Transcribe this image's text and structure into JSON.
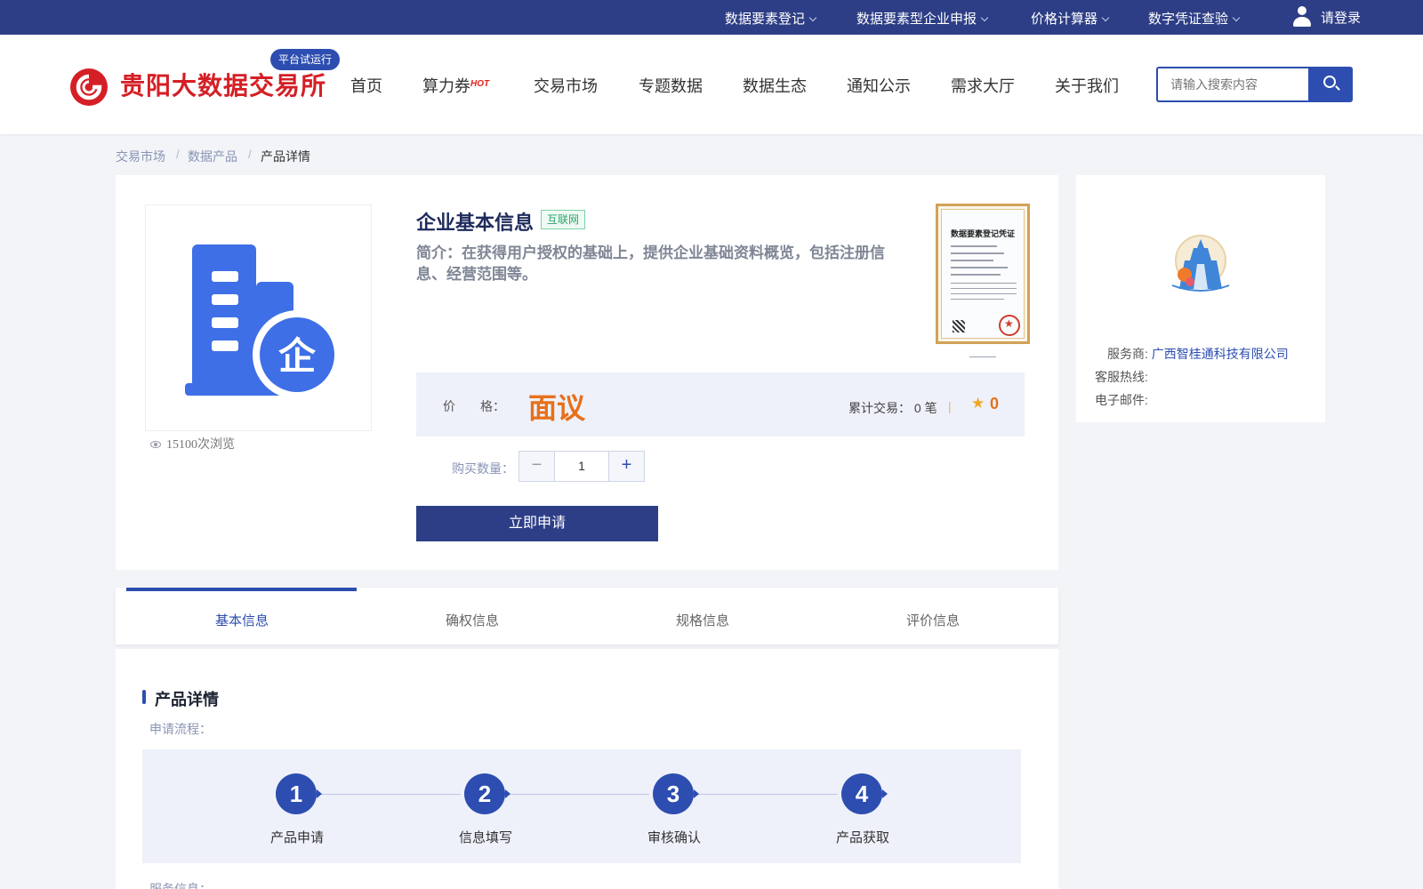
{
  "topbar": {
    "links": [
      "数据要素登记",
      "数据要素型企业申报",
      "价格计算器",
      "数字凭证查验"
    ],
    "login_label": "请登录"
  },
  "header": {
    "logo_text": "贵阳大数据交易所",
    "beta_badge": "平台试运行",
    "nav": [
      "首页",
      "算力券",
      "交易市场",
      "专题数据",
      "数据生态",
      "通知公示",
      "需求大厅",
      "关于我们"
    ],
    "hot_tag": "HOT",
    "search_placeholder": "请输入搜索内容"
  },
  "breadcrumb": [
    "交易市场",
    "数据产品",
    "产品详情"
  ],
  "product": {
    "title": "企业基本信息",
    "tag": "互联网",
    "description": "简介：在获得用户授权的基础上，提供企业基础资料概览，包括注册信息、经营范围等。",
    "certificate_title": "数据要素登记凭证",
    "views": "15100次浏览",
    "price_label": "价　　格：",
    "price_value": "面议",
    "trade_count": "累计交易： 0 笔",
    "trade_sep": "|",
    "rating": "0",
    "qty_label": "购买数量：",
    "qty_value": "1",
    "apply_label": "立即申请"
  },
  "provider": {
    "provider_label": "服务商:",
    "provider_name": "广西智桂通科技有限公司",
    "hotline_label": "客服热线:",
    "email_label": "电子邮件:"
  },
  "tabs": [
    "基本信息",
    "确权信息",
    "规格信息",
    "评价信息"
  ],
  "detail": {
    "section_title": "产品详情",
    "process_label": "申请流程：",
    "steps": [
      {
        "num": "1",
        "name": "产品申请"
      },
      {
        "num": "2",
        "name": "信息填写"
      },
      {
        "num": "3",
        "name": "审核确认"
      },
      {
        "num": "4",
        "name": "产品获取"
      }
    ],
    "service_label": "服务信息："
  },
  "colors": {
    "brand_red": "#d51f26",
    "primary_blue": "#2d3e86",
    "accent_blue": "#2d4eb0",
    "price_orange": "#e7701a",
    "tag_green": "#2da36c"
  },
  "icons": [
    "user-icon",
    "chevron-down-icon",
    "search-icon",
    "eye-icon",
    "star-icon",
    "minus-icon",
    "plus-icon",
    "building-icon"
  ]
}
